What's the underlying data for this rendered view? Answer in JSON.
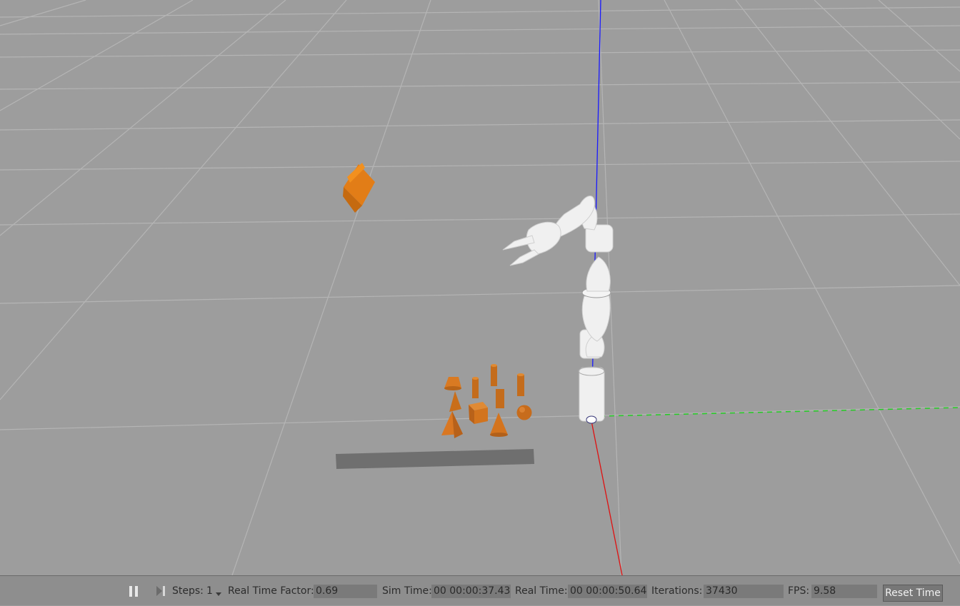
{
  "toolbar": {
    "pause_icon": "pause-icon",
    "step_icon": "step-forward-icon",
    "steps_label": "Steps:",
    "steps_value": "1",
    "steps_dropdown_icon": "caret-down-icon",
    "rtf_label": "Real Time Factor:",
    "rtf_value": "0.69",
    "sim_time_label": "Sim Time:",
    "sim_time_value": "00 00:00:37.430",
    "real_time_label": "Real Time:",
    "real_time_value": "00 00:00:50.647",
    "iterations_label": "Iterations:",
    "iterations_value": "37430",
    "fps_label": "FPS:",
    "fps_value": "9.58",
    "reset_time_label": "Reset Time"
  },
  "colors": {
    "ground": "#9d9d9d",
    "grid_line": "#b8b8b8",
    "object_orange": "#d97a1e",
    "axis_x": "#e01010",
    "axis_y": "#22cc22",
    "axis_z": "#1a1aff",
    "robot": "#f2f2f2"
  }
}
